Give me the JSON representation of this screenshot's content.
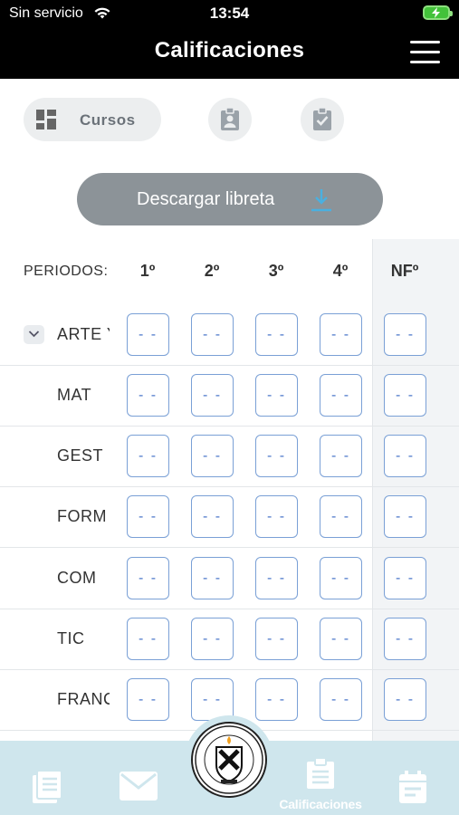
{
  "status_bar": {
    "carrier": "Sin servicio",
    "time": "13:54"
  },
  "header": {
    "title": "Calificaciones"
  },
  "segments": {
    "cursos_label": "Cursos"
  },
  "download": {
    "label": "Descargar libreta"
  },
  "table": {
    "periods_label": "PERIODOS:",
    "period_headers": [
      "1º",
      "2º",
      "3º",
      "4º",
      "NFº"
    ],
    "empty_value": "- -",
    "rows": [
      {
        "subject": "ARTE Y CULTURA"
      },
      {
        "subject": "MAT"
      },
      {
        "subject": "GEST"
      },
      {
        "subject": "FORM"
      },
      {
        "subject": "COM"
      },
      {
        "subject": "TIC"
      },
      {
        "subject": "FRANCÉS"
      }
    ]
  },
  "bottom_nav": {
    "active_label": "Calificaciones",
    "items": [
      "reading-icon",
      "mail-icon",
      "school-logo",
      "grades-icon",
      "calendar-icon"
    ]
  },
  "colors": {
    "header_bg": "#000000",
    "download_bg": "#8c9398",
    "cell_border": "#7aa0d6",
    "bottom_bg": "#cfe6ed"
  }
}
